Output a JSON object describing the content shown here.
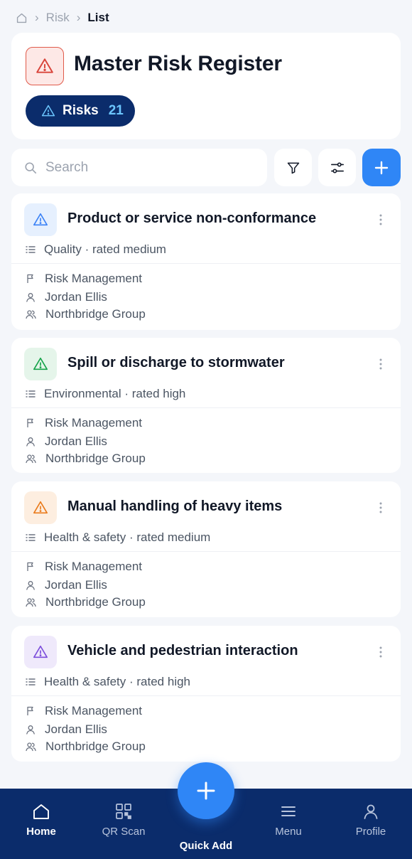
{
  "breadcrumb": {
    "icon": "home-icon",
    "items": [
      "Risk",
      "List"
    ]
  },
  "header": {
    "icon": "warning-triangle-icon",
    "title": "Master Risk Register",
    "pill_label": "Risks",
    "pill_count": "21"
  },
  "toolbar": {
    "search_placeholder": "Search",
    "filter_icon": "filter-icon",
    "settings_icon": "sliders-icon",
    "add_icon": "plus-icon"
  },
  "risks": [
    {
      "title": "Product or service non-conformance",
      "category": "Quality · rated medium",
      "module": "Risk Management",
      "owner": "Jordan Ellis",
      "org": "Northbridge Group",
      "icon_color": "#3b82f6",
      "icon_bg": "#e6f0fe"
    },
    {
      "title": "Spill or discharge to stormwater",
      "category": "Environmental · rated high",
      "module": "Risk Management",
      "owner": "Jordan Ellis",
      "org": "Northbridge Group",
      "icon_color": "#16a34a",
      "icon_bg": "#e5f5ea"
    },
    {
      "title": "Manual handling of heavy items",
      "category": "Health & safety · rated medium",
      "module": "Risk Management",
      "owner": "Jordan Ellis",
      "org": "Northbridge Group",
      "icon_color": "#ea7a1a",
      "icon_bg": "#fdeee0"
    },
    {
      "title": "Vehicle and pedestrian interaction",
      "category": "Health & safety · rated high",
      "module": "Risk Management",
      "owner": "Jordan Ellis",
      "org": "Northbridge Group",
      "icon_color": "#7c4ddb",
      "icon_bg": "#efe9fb"
    }
  ],
  "nav": {
    "home": "Home",
    "qr": "QR Scan",
    "quick_add": "Quick Add",
    "menu": "Menu",
    "profile": "Profile"
  },
  "colors": {
    "brand_navy": "#0b2c6b",
    "accent_blue": "#2f86f6",
    "alert_red": "#e05a4a",
    "count_blue": "#6cc6ff"
  }
}
